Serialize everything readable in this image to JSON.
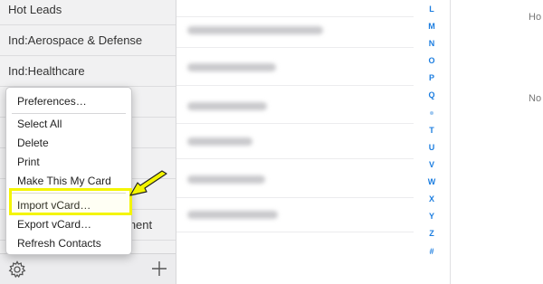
{
  "sidebar": {
    "groups": [
      "Hot Leads",
      "Ind:Aerospace & Defense",
      "Ind:Healthcare",
      "",
      "",
      "",
      "",
      "ement"
    ]
  },
  "menu": {
    "items": [
      "Preferences…",
      "Select All",
      "Delete",
      "Print",
      "Make This My Card",
      "Import vCard…",
      "Export vCard…",
      "Refresh Contacts"
    ]
  },
  "icons": {
    "gear": "gear-icon",
    "plus": "plus-icon",
    "arrow": "yellow-arrow-annotation"
  },
  "alphabet": [
    "L",
    "M",
    "N",
    "O",
    "P",
    "Q",
    "•",
    "T",
    "U",
    "V",
    "W",
    "X",
    "Y",
    "Z",
    "#"
  ],
  "detail": {
    "line1": "Ho",
    "line2": "No"
  },
  "colors": {
    "highlight": "#f4f500",
    "index_blue": "#1b7de0"
  }
}
